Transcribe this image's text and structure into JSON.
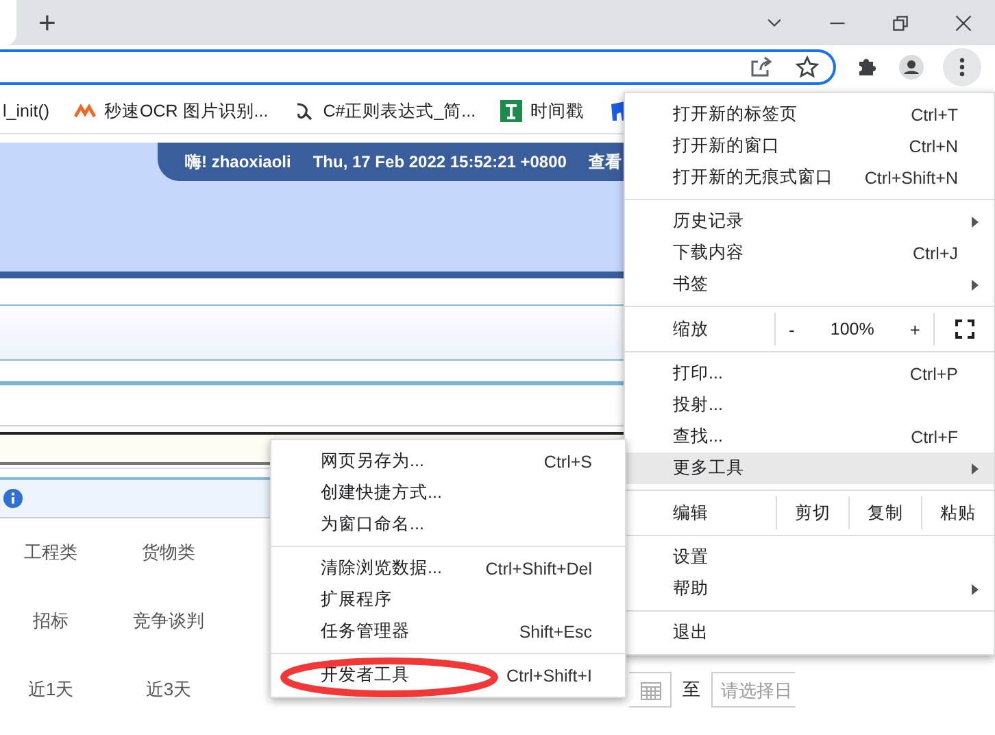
{
  "tab_strip": {
    "new_tab": "+"
  },
  "bookmarks": [
    {
      "kind": "plain",
      "label": "l_init()"
    },
    {
      "kind": "m-logo",
      "label": "秒速OCR 图片识别..."
    },
    {
      "kind": "hook",
      "label": "C#正则表达式_简..."
    },
    {
      "kind": "green-t",
      "label": "时间戳"
    }
  ],
  "header": {
    "greeting": "嗨! zhaoxiaoli",
    "datetime": "Thu, 17 Feb 2022 15:52:21 +0800",
    "link": "查看"
  },
  "filters": [
    [
      "工程类",
      "货物类"
    ],
    [
      "招标",
      "竞争谈判"
    ],
    [
      "近1天",
      "近3天"
    ]
  ],
  "date_range": {
    "separator": "至",
    "end_placeholder": "请选择日"
  },
  "main_menu": [
    [
      {
        "kind": "item",
        "label": "打开新的标签页",
        "shortcut": "Ctrl+T",
        "submenu": false,
        "selected": false
      },
      {
        "kind": "item",
        "label": "打开新的窗口",
        "shortcut": "Ctrl+N",
        "submenu": false,
        "selected": false
      },
      {
        "kind": "item",
        "label": "打开新的无痕式窗口",
        "shortcut": "Ctrl+Shift+N",
        "submenu": false,
        "selected": false
      }
    ],
    [
      {
        "kind": "item",
        "label": "历史记录",
        "submenu": true,
        "selected": false
      },
      {
        "kind": "item",
        "label": "下载内容",
        "shortcut": "Ctrl+J",
        "submenu": false,
        "selected": false
      },
      {
        "kind": "item",
        "label": "书签",
        "submenu": true,
        "selected": false
      }
    ],
    [
      {
        "kind": "zoom",
        "label": "缩放",
        "minus": "-",
        "value": "100%",
        "plus": "+"
      }
    ],
    [
      {
        "kind": "item",
        "label": "打印...",
        "shortcut": "Ctrl+P",
        "submenu": false,
        "selected": false
      },
      {
        "kind": "item",
        "label": "投射...",
        "submenu": false,
        "selected": false
      },
      {
        "kind": "item",
        "label": "查找...",
        "shortcut": "Ctrl+F",
        "submenu": false,
        "selected": false
      },
      {
        "kind": "item",
        "label": "更多工具",
        "submenu": true,
        "selected": true
      }
    ],
    [
      {
        "kind": "edit",
        "label": "编辑",
        "buttons": [
          "剪切",
          "复制",
          "粘贴"
        ]
      }
    ],
    [
      {
        "kind": "item",
        "label": "设置",
        "submenu": false,
        "selected": false
      },
      {
        "kind": "item",
        "label": "帮助",
        "submenu": true,
        "selected": false
      }
    ],
    [
      {
        "kind": "item",
        "label": "退出",
        "submenu": false,
        "selected": false
      }
    ]
  ],
  "sub_menu": [
    [
      {
        "label": "网页另存为...",
        "shortcut": "Ctrl+S",
        "circled": false
      },
      {
        "label": "创建快捷方式...",
        "circled": false
      },
      {
        "label": "为窗口命名...",
        "circled": false
      }
    ],
    [
      {
        "label": "清除浏览数据...",
        "shortcut": "Ctrl+Shift+Del",
        "circled": false
      },
      {
        "label": "扩展程序",
        "circled": false
      },
      {
        "label": "任务管理器",
        "shortcut": "Shift+Esc",
        "circled": false
      }
    ],
    [
      {
        "label": "开发者工具",
        "shortcut": "Ctrl+Shift+I",
        "circled": true
      }
    ]
  ]
}
